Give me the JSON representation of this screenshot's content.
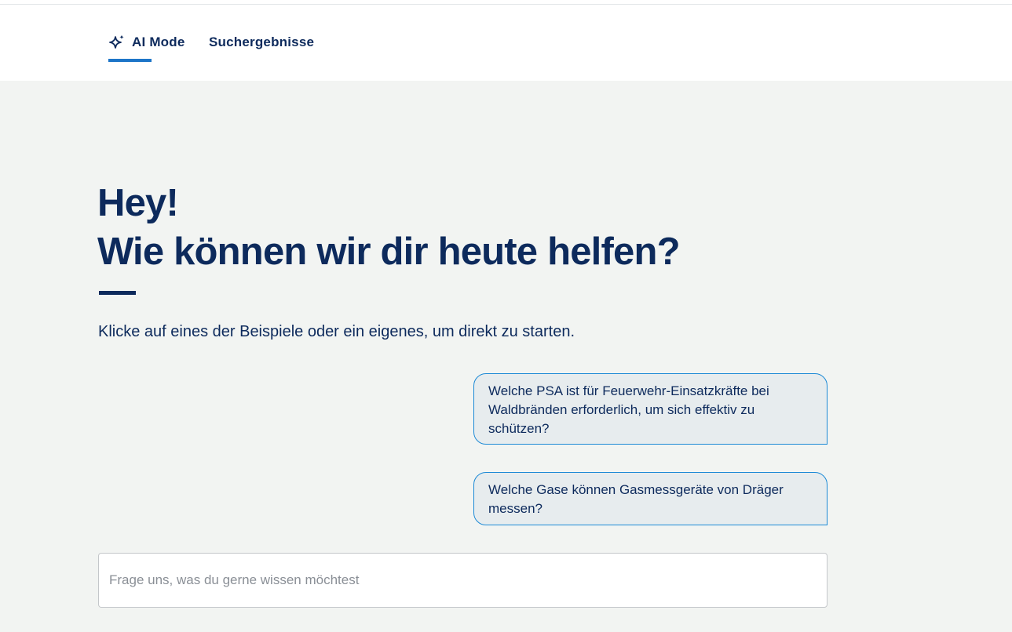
{
  "nav": {
    "tabs": [
      {
        "label": "AI Mode",
        "icon": "sparkle-icon",
        "active": true
      },
      {
        "label": "Suchergebnisse",
        "active": false
      }
    ]
  },
  "hero": {
    "greeting": "Hey!",
    "question": "Wie können wir dir heute helfen?",
    "intro": "Klicke auf eines der Beispiele oder ein eigenes, um direkt zu starten."
  },
  "suggestions": [
    "Welche PSA ist für Feuerwehr-Einsatzkräfte bei Waldbränden erforderlich, um sich effektiv zu schützen?",
    "Welche Gase können Gasmessgeräte von Dräger messen?"
  ],
  "chat_input": {
    "placeholder": "Frage uns, was du gerne wissen möchtest",
    "value": ""
  },
  "colors": {
    "brand_navy": "#0d2a5c",
    "accent_blue": "#1d75c8",
    "suggestion_border": "#1d8ad6",
    "page_background": "#f2f4f2"
  }
}
